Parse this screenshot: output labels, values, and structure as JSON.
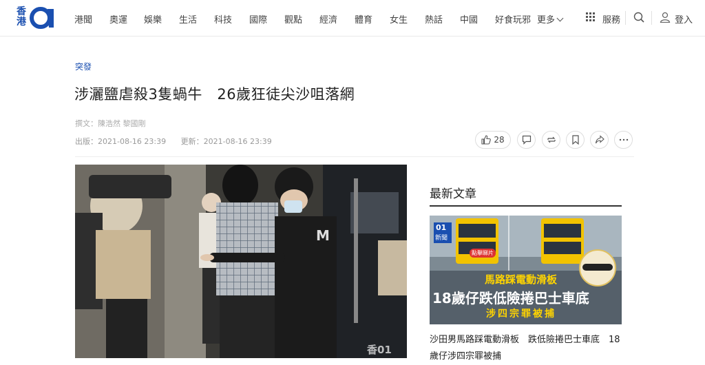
{
  "brand": {
    "logo_text": "香港",
    "logo_mark": "01",
    "colors": {
      "accent": "#1a4fb0",
      "text": "#222222",
      "muted": "#999999"
    }
  },
  "nav": {
    "items": [
      "港聞",
      "奧運",
      "娛樂",
      "生活",
      "科技",
      "國際",
      "觀點",
      "經濟",
      "體育",
      "女生",
      "熱話",
      "中國",
      "好食玩邪"
    ],
    "more_label": "更多",
    "services_label": "服務",
    "login_label": "登入",
    "icons": [
      "grid-icon",
      "search-icon",
      "user-icon",
      "chevron-down-icon"
    ]
  },
  "article": {
    "category": "突發",
    "headline": "涉灑鹽虐殺3隻蝸牛　26歲狂徒尖沙咀落網",
    "byline": "撰文：陳浩然 黎國剛",
    "published": "出版：2021-08-16 23:39",
    "updated": "更新：2021-08-16 23:39",
    "like_count": "28",
    "action_icons": [
      "thumbs-up-icon",
      "comment-icon",
      "share-repost-icon",
      "bookmark-icon",
      "share-icon",
      "more-icon"
    ],
    "image_watermark": "香01"
  },
  "sidebar": {
    "title": "最新文章",
    "thumb": {
      "badge_mark": "01",
      "badge_text": "新聞",
      "tag": "點擊睇片",
      "line1": "馬路踩電動滑板",
      "line2": "18歲仔跌低險捲巴士車底",
      "line3": "涉四宗罪被捕"
    },
    "caption": "沙田男馬路踩電動滑板　跌低險捲巴士車底　18歲仔涉四宗罪被捕"
  }
}
